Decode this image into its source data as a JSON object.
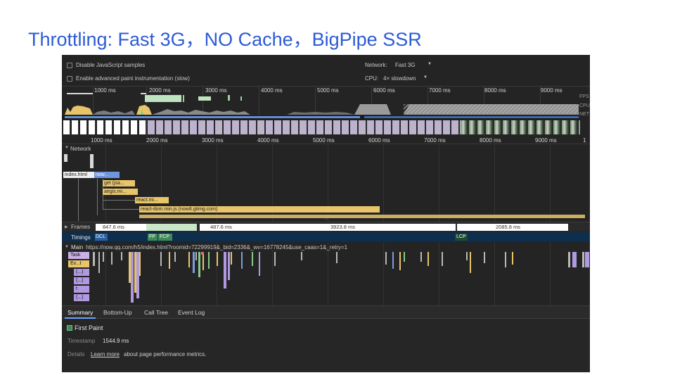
{
  "slide": {
    "title": "Throttling: Fast 3G，NO Cache，BigPipe SSR"
  },
  "toolbar": {
    "disable_js_samples": "Disable JavaScript samples",
    "enable_paint": "Enable advanced paint instrumentation (slow)",
    "network_label": "Network:",
    "network_value": "Fast 3G",
    "cpu_label": "CPU:",
    "cpu_value": "4× slowdown"
  },
  "overview": {
    "ticks": [
      "1000 ms",
      "2000 ms",
      "3000 ms",
      "4000 ms",
      "5000 ms",
      "6000 ms",
      "7000 ms",
      "8000 ms",
      "9000 ms"
    ],
    "side_labels": [
      "FPS",
      "CPU",
      "NET"
    ]
  },
  "timeline": {
    "ticks": [
      "1000 ms",
      "2000 ms",
      "3000 ms",
      "4000 ms",
      "5000 ms",
      "6000 ms",
      "7000 ms",
      "8000 ms",
      "9000 ms",
      "1"
    ]
  },
  "network": {
    "label": "Network",
    "requests": [
      {
        "label": "index.html",
        "tail": "now..."
      },
      {
        "label": "get (jsa..."
      },
      {
        "label": "aegis.mi..."
      },
      {
        "label": "react.mi..."
      },
      {
        "label": "react-dom.min.js (now8.gtimg.com)"
      }
    ]
  },
  "frames": {
    "label": "Frames",
    "values": [
      "847.6 ms",
      "487.6 ms",
      "3923.8 ms",
      "2085.8 ms"
    ]
  },
  "timings": {
    "label": "Timings",
    "markers": [
      "DCL",
      "FP",
      "FCP",
      "LCP"
    ]
  },
  "main": {
    "label": "Main",
    "url": "https://now.qq.com/h5/index.html?roomid=72299919&_bid=2336&_wv=16778245&use_caas=1&_retry=1",
    "rows": [
      "Task",
      "Ev...t",
      "(...)",
      "(...)",
      "t",
      "(...)"
    ]
  },
  "bottom": {
    "tabs": [
      "Summary",
      "Bottom-Up",
      "Call Tree",
      "Event Log"
    ],
    "event_name": "First Paint",
    "timestamp_label": "Timestamp",
    "timestamp_value": "1544.9 ms",
    "details_label": "Details",
    "details_link": "Learn more",
    "details_text": "about page performance metrics."
  },
  "colors": {
    "title": "#2c5bd6",
    "panel": "#242424",
    "scripting": "#e8c56a",
    "loading": "#7c9ddb",
    "painting": "#86c98a",
    "rendering": "#b09adf",
    "timing_fp": "#3f8a58",
    "timing_lcp": "#1e4a32"
  }
}
